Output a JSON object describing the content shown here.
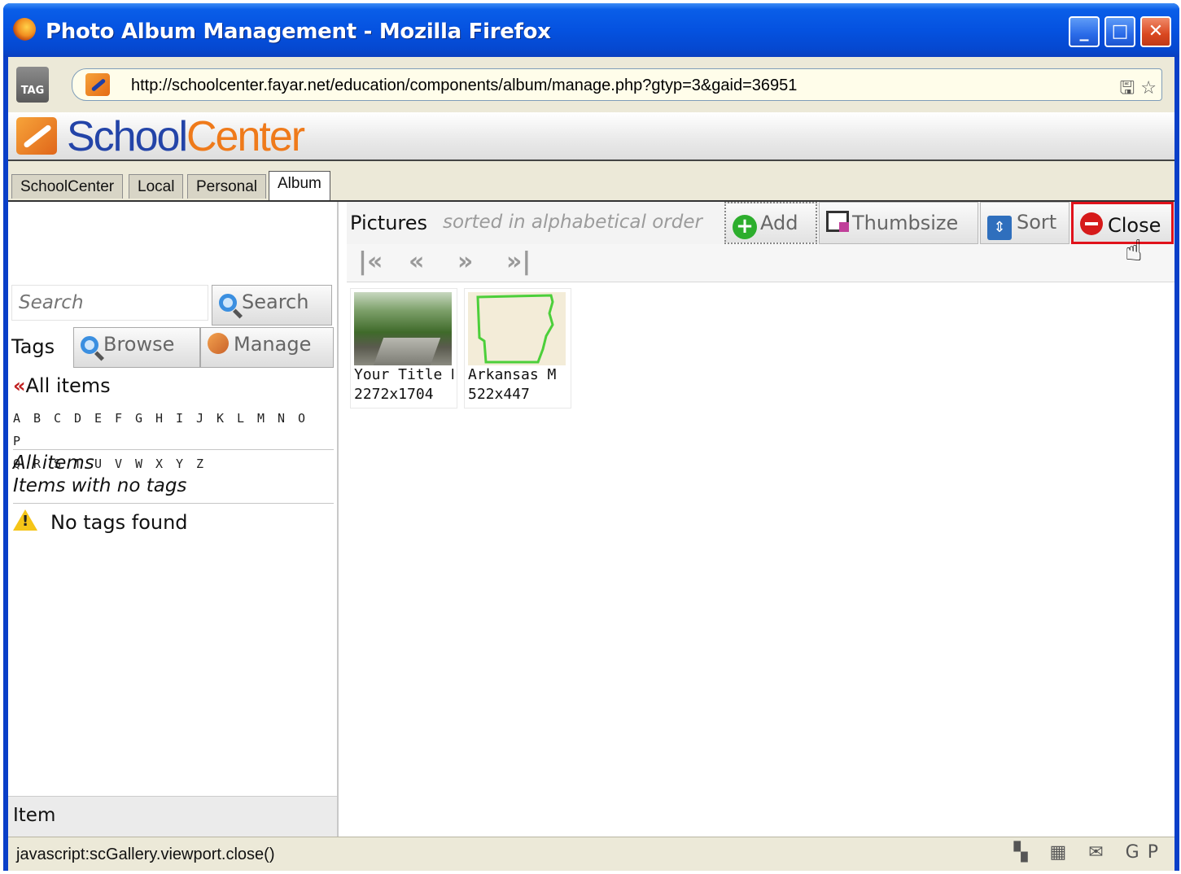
{
  "window": {
    "title": "Photo Album Management - Mozilla Firefox",
    "minimize_glyph": "_",
    "maximize_glyph": "□",
    "close_glyph": "✕"
  },
  "urlbar": {
    "tag_label": "TAG",
    "url": "http://schoolcenter.fayar.net/education/components/album/manage.php?gtyp=3&gaid=36951",
    "right_icons": "🖫 ☆"
  },
  "brand": {
    "part1": "School",
    "part2": "Center"
  },
  "tabs": [
    {
      "label": "SchoolCenter",
      "active": false
    },
    {
      "label": "Local",
      "active": false
    },
    {
      "label": "Personal",
      "active": false
    },
    {
      "label": "Album",
      "active": true
    }
  ],
  "left": {
    "search_placeholder": "Search",
    "search_button": "Search",
    "tags_label": "Tags",
    "browse_button": "Browse",
    "manage_button": "Manage",
    "all_items_arrows": "«",
    "all_items_link": "All items",
    "letters_row1": [
      "A",
      "B",
      "C",
      "D",
      "E",
      "F",
      "G",
      "H",
      "I",
      "J",
      "K",
      "L",
      "M",
      "N",
      "O",
      "P"
    ],
    "letters_row2": [
      "Q",
      "R",
      "S",
      "T",
      "U",
      "V",
      "W",
      "X",
      "Y",
      "Z"
    ],
    "filter_all": "All items",
    "filter_notags": "Items with no tags",
    "no_tags_message": "No tags found",
    "footer_label": "Item"
  },
  "pictures": {
    "label": "Pictures",
    "sort_note": "sorted in alphabetical order",
    "add_button": "Add",
    "thumbsize_button": "Thumbsize",
    "sort_button": "Sort",
    "close_button": "Close",
    "pager": {
      "first": "|«",
      "prev": "«",
      "next": "»",
      "last": "»|"
    },
    "items": [
      {
        "title": "Your Title H",
        "size": "2272x1704"
      },
      {
        "title": "Arkansas M",
        "size": "522x447"
      }
    ]
  },
  "status": {
    "text": "javascript:scGallery.viewport.close()",
    "icons": "▚ ▦ ✉ GP"
  },
  "colors": {
    "title_blue": "#0552e0",
    "brand_blue": "#2344a8",
    "brand_orange": "#ef7a1a",
    "close_highlight": "#e0121b"
  }
}
